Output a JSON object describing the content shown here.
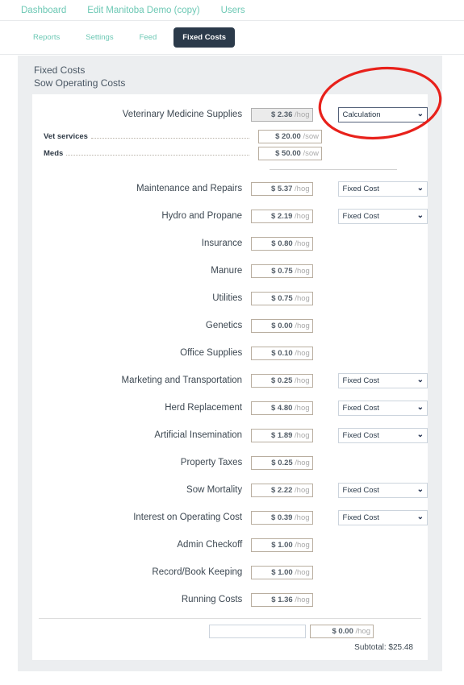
{
  "topnav": {
    "items": [
      {
        "label": "Dashboard"
      },
      {
        "label": "Edit Manitoba Demo (copy)"
      },
      {
        "label": "Users"
      }
    ]
  },
  "subnav": {
    "items": [
      {
        "label": "Reports",
        "active": false
      },
      {
        "label": "Settings",
        "active": false
      },
      {
        "label": "Feed",
        "active": false
      },
      {
        "label": "Fixed Costs",
        "active": true
      }
    ]
  },
  "card": {
    "title": "Fixed Costs",
    "subtitle": "Sow Operating Costs",
    "rows": [
      {
        "label": "Veterinary Medicine Supplies",
        "amount": "$ 2.36",
        "unit": "/hog",
        "disabled": true,
        "select": "Calculation",
        "select_focused": true,
        "subrows": [
          {
            "label": "Vet services",
            "amount": "$ 20.00",
            "unit": "/sow"
          },
          {
            "label": "Meds",
            "amount": "$ 50.00",
            "unit": "/sow"
          }
        ]
      },
      {
        "label": "Maintenance and Repairs",
        "amount": "$ 5.37",
        "unit": "/hog",
        "select": "Fixed Cost"
      },
      {
        "label": "Hydro and Propane",
        "amount": "$ 2.19",
        "unit": "/hog",
        "select": "Fixed Cost"
      },
      {
        "label": "Insurance",
        "amount": "$ 0.80",
        "unit": "/hog",
        "select": null
      },
      {
        "label": "Manure",
        "amount": "$ 0.75",
        "unit": "/hog",
        "select": null
      },
      {
        "label": "Utilities",
        "amount": "$ 0.75",
        "unit": "/hog",
        "select": null
      },
      {
        "label": "Genetics",
        "amount": "$ 0.00",
        "unit": "/hog",
        "select": null
      },
      {
        "label": "Office Supplies",
        "amount": "$ 0.10",
        "unit": "/hog",
        "select": null
      },
      {
        "label": "Marketing and Transportation",
        "amount": "$ 0.25",
        "unit": "/hog",
        "select": "Fixed Cost"
      },
      {
        "label": "Herd Replacement",
        "amount": "$ 4.80",
        "unit": "/hog",
        "select": "Fixed Cost"
      },
      {
        "label": "Artificial Insemination",
        "amount": "$ 1.89",
        "unit": "/hog",
        "select": "Fixed Cost"
      },
      {
        "label": "Property Taxes",
        "amount": "$ 0.25",
        "unit": "/hog",
        "select": null
      },
      {
        "label": "Sow Mortality",
        "amount": "$ 2.22",
        "unit": "/hog",
        "select": "Fixed Cost"
      },
      {
        "label": "Interest on Operating Cost",
        "amount": "$ 0.39",
        "unit": "/hog",
        "select": "Fixed Cost"
      },
      {
        "label": "Admin Checkoff",
        "amount": "$ 1.00",
        "unit": "/hog",
        "select": null
      },
      {
        "label": "Record/Book Keeping",
        "amount": "$ 1.00",
        "unit": "/hog",
        "select": null
      },
      {
        "label": "Running Costs",
        "amount": "$ 1.36",
        "unit": "/hog",
        "select": null
      }
    ],
    "add_row": {
      "name_placeholder": "",
      "name_value": "",
      "amount": "$ 0.00",
      "unit": "/hog"
    },
    "subtotal": "Subtotal: $25.48"
  },
  "annotation": {
    "shape": "ellipse",
    "color": "#e8211b",
    "target": "Calculation dropdown and sow sub-cost fields"
  },
  "colors": {
    "accent_teal": "#6cc8b4",
    "pill_active_bg": "#2b3a4a",
    "card_bg": "#eceef0",
    "annotation_red": "#e8211b"
  }
}
